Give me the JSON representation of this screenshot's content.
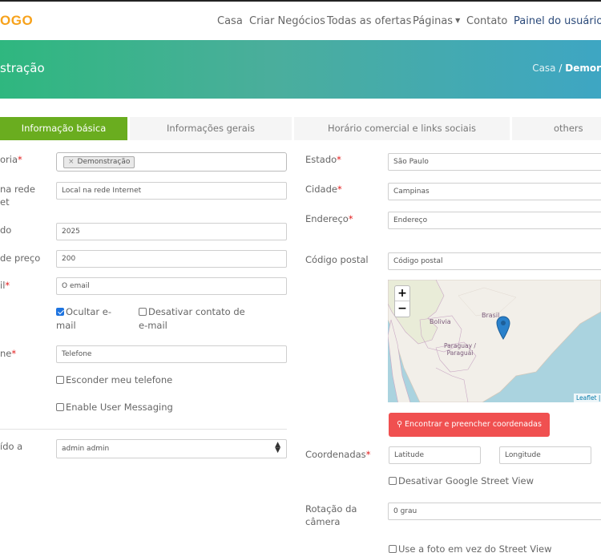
{
  "header": {
    "logo": "OGO",
    "nav": [
      "Casa",
      "Criar Negócios",
      "Todas as ofertas",
      "Páginas",
      "Contato",
      "Painel do usuário"
    ]
  },
  "banner": {
    "title": "stração",
    "breadcrumb_home": "Casa",
    "breadcrumb_sep": "/",
    "breadcrumb_current": "Demor"
  },
  "tabs": [
    "Informação básica",
    "Informações gerais",
    "Horário comercial e links sociais",
    "others"
  ],
  "left": {
    "category_label": "oria",
    "category_tag": "Demonstração",
    "online_label_1": "na rede",
    "online_label_2": "et",
    "online_value": "Local na rede Internet",
    "founded_label": "do",
    "founded_value": "2025",
    "price_label": "de preço",
    "price_value": "200",
    "email_label": "il",
    "email_placeholder": "O email",
    "hide_email": "Ocultar e-mail",
    "disable_contact": "Desativar contato de e-mail",
    "phone_label": "ne",
    "phone_placeholder": "Telefone",
    "hide_phone": "Esconder meu telefone",
    "user_messaging": "Enable User Messaging",
    "assigned_label": "ído a",
    "assigned_value": "admin admin"
  },
  "right": {
    "state_label": "Estado",
    "state_value": "São Paulo",
    "city_label": "Cidade",
    "city_value": "Campinas",
    "address_label": "Endereço",
    "address_placeholder": "Endereço",
    "zip_label": "Código postal",
    "zip_placeholder": "Código postal",
    "map": {
      "country_brasil": "Brasil",
      "country_bolivia": "Bolivia",
      "country_paraguay_1": "Paraguay /",
      "country_paraguay_2": "Paraguái",
      "zoom_in": "+",
      "zoom_out": "−",
      "attribution": "Leaflet |"
    },
    "find_button": "Encontrar e preencher coordenadas",
    "coords_label": "Coordenadas",
    "latitude_placeholder": "Latitude",
    "longitude_placeholder": "Longitude",
    "disable_streetview": "Desativar Google Street View",
    "rotation_label_1": "Rotação da",
    "rotation_label_2": "câmera",
    "rotation_value": "0 grau",
    "use_photo": "Use a foto em vez do Street View"
  },
  "required_mark": "*",
  "colors": {
    "accent_green": "#6aad1f",
    "logo_orange": "#f7a21b",
    "required_red": "#e21b1b",
    "button_red": "#f05050"
  }
}
